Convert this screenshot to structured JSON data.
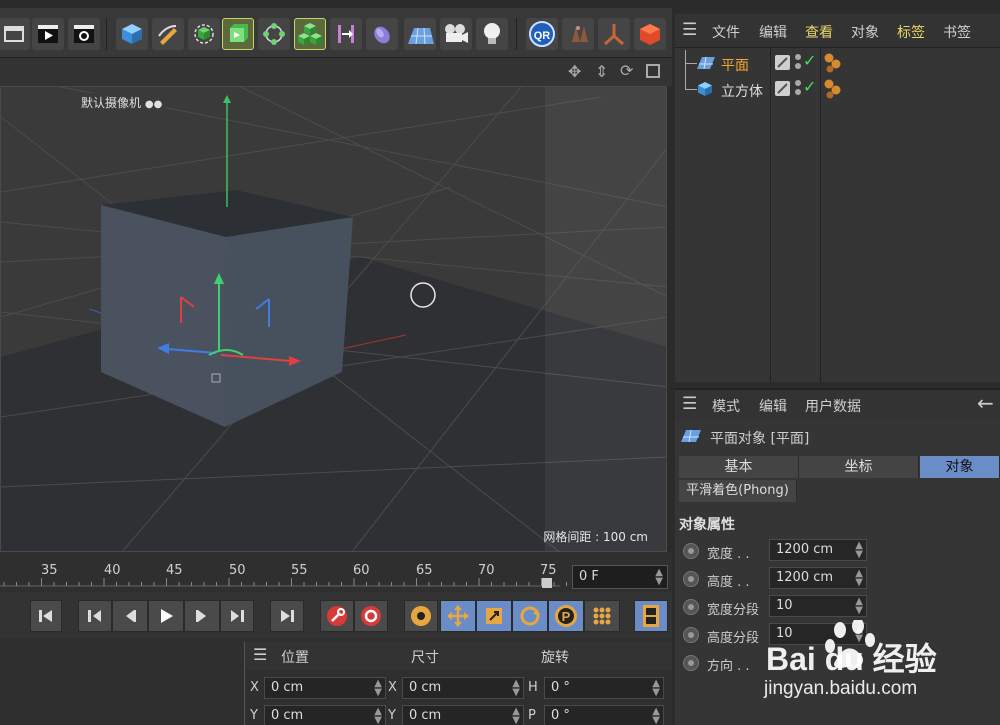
{
  "viewport": {
    "camera_label": "默认摄像机",
    "grid_spacing": "网格间距 : 100 cm"
  },
  "timeline": {
    "ticks": [
      "35",
      "40",
      "45",
      "50",
      "55",
      "60",
      "65",
      "70",
      "75"
    ],
    "current_frame": "0 F"
  },
  "coords": {
    "position_label": "位置",
    "size_label": "尺寸",
    "rotation_label": "旋转",
    "rows": [
      {
        "axis1": "X",
        "pos": "0 cm",
        "axis2": "X",
        "size": "0 cm",
        "axis3": "H",
        "rot": "0 °"
      },
      {
        "axis1": "Y",
        "pos": "0 cm",
        "axis2": "Y",
        "size": "0 cm",
        "axis3": "P",
        "rot": "0 °"
      }
    ]
  },
  "object_manager": {
    "menu": [
      "文件",
      "编辑",
      "查看",
      "对象",
      "标签",
      "书签"
    ],
    "objects": [
      {
        "name": "平面",
        "selected": true
      },
      {
        "name": "立方体",
        "selected": false
      }
    ]
  },
  "attribute_manager": {
    "menu": [
      "模式",
      "编辑",
      "用户数据"
    ],
    "object_title": "平面对象 [平面]",
    "tabs": [
      "基本",
      "坐标",
      "对象"
    ],
    "active_tab": "对象",
    "phong_tab": "平滑着色(Phong)",
    "section_title": "对象属性",
    "fields": [
      {
        "label": "宽度 . .",
        "value": "1200 cm"
      },
      {
        "label": "高度 . .",
        "value": "1200 cm"
      },
      {
        "label": "宽度分段",
        "value": "10"
      },
      {
        "label": "高度分段",
        "value": "10"
      },
      {
        "label": "方向 . .",
        "value": ""
      }
    ]
  },
  "watermark": {
    "brand": "Bai du 经验",
    "url": "jingyan.baidu.com"
  },
  "colors": {
    "accent_blue": "#6a8dc7",
    "selection_orange": "#f0a830",
    "check_green": "#4cd964"
  }
}
